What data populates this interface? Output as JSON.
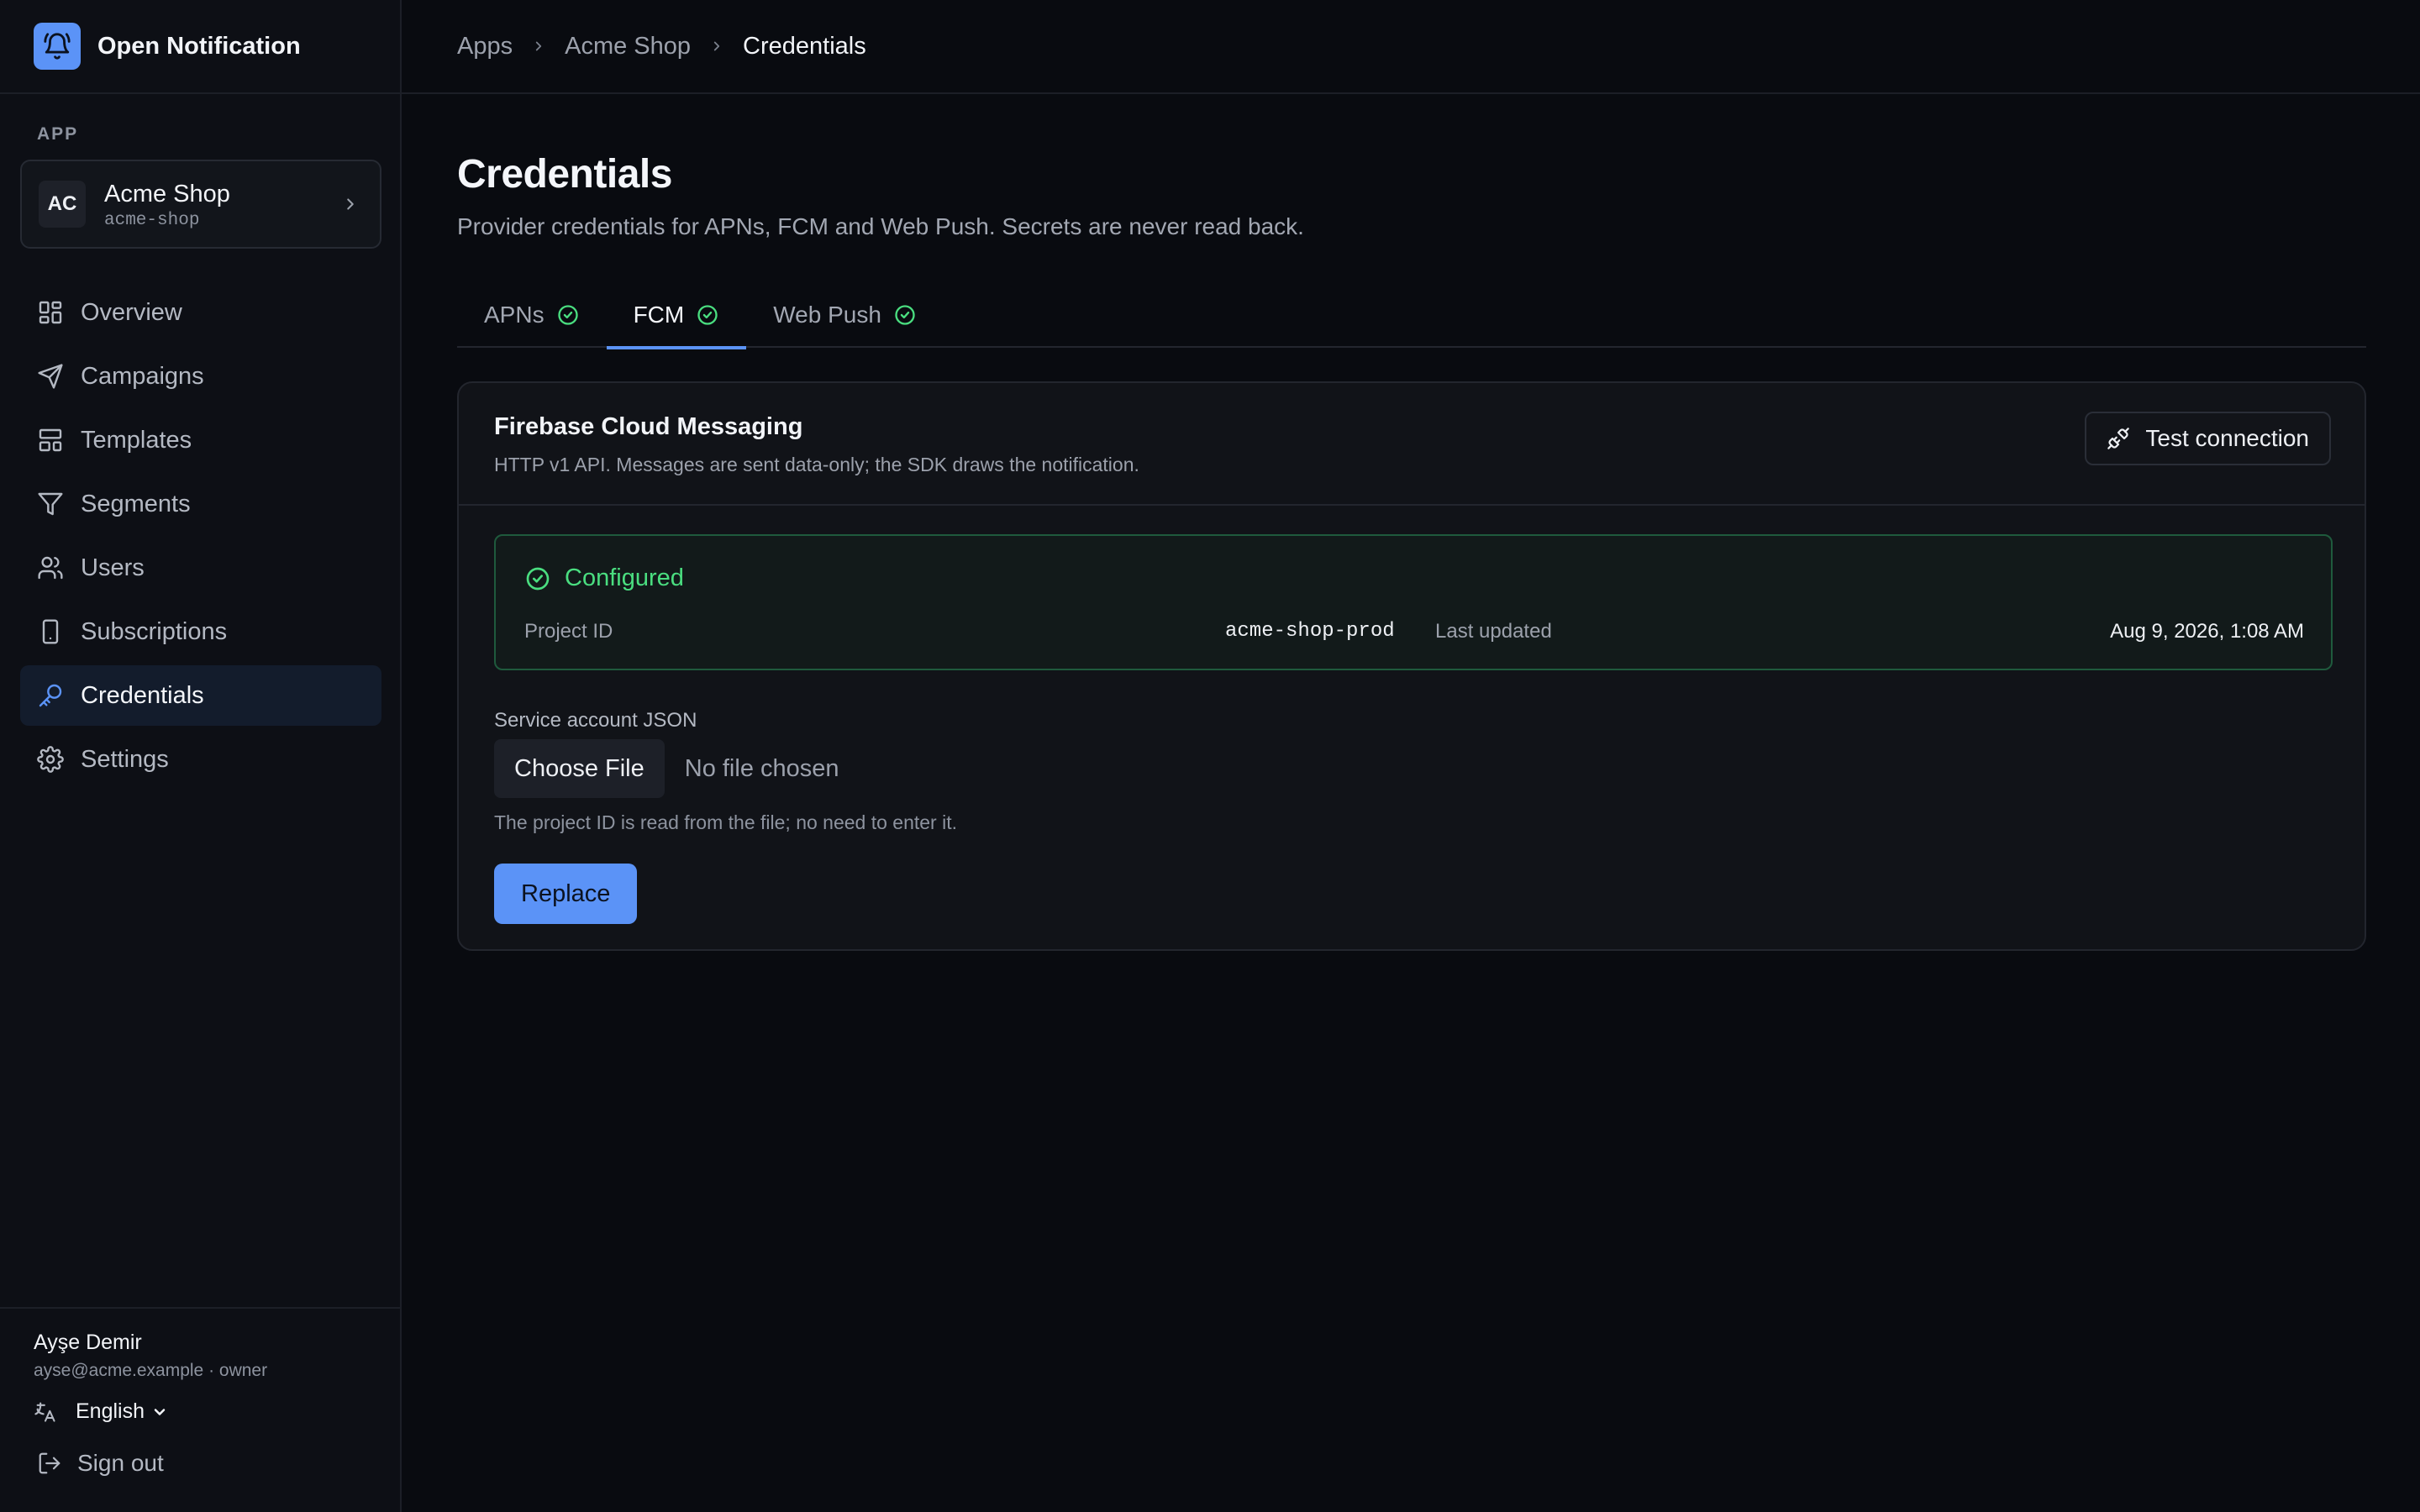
{
  "brand": {
    "name": "Open Notification"
  },
  "sidebar": {
    "section_label": "APP",
    "app": {
      "avatar": "AC",
      "name": "Acme Shop",
      "slug": "acme-shop"
    },
    "items": [
      {
        "label": "Overview",
        "icon": "grid-icon"
      },
      {
        "label": "Campaigns",
        "icon": "send-icon"
      },
      {
        "label": "Templates",
        "icon": "layout-icon"
      },
      {
        "label": "Segments",
        "icon": "filter-icon"
      },
      {
        "label": "Users",
        "icon": "users-icon"
      },
      {
        "label": "Subscriptions",
        "icon": "smartphone-icon"
      },
      {
        "label": "Credentials",
        "icon": "key-icon",
        "active": true
      },
      {
        "label": "Settings",
        "icon": "gear-icon"
      }
    ],
    "user": {
      "name": "Ayşe Demir",
      "meta": "ayse@acme.example · owner"
    },
    "language": "English",
    "signout": "Sign out"
  },
  "breadcrumb": [
    "Apps",
    "Acme Shop",
    "Credentials"
  ],
  "page": {
    "title": "Credentials",
    "subtitle": "Provider credentials for APNs, FCM and Web Push. Secrets are never read back."
  },
  "tabs": [
    {
      "label": "APNs",
      "configured": true
    },
    {
      "label": "FCM",
      "configured": true,
      "active": true
    },
    {
      "label": "Web Push",
      "configured": true
    }
  ],
  "card": {
    "title": "Firebase Cloud Messaging",
    "description": "HTTP v1 API. Messages are sent data-only; the SDK draws the notification.",
    "test_button": "Test connection",
    "status": {
      "label": "Configured",
      "project_id_label": "Project ID",
      "project_id": "acme-shop-prod",
      "updated_label": "Last updated",
      "updated": "Aug 9, 2026, 1:08 AM"
    },
    "field_label": "Service account JSON",
    "file_button": "Choose File",
    "file_status": "No file chosen",
    "hint": "The project ID is read from the file; no need to enter it.",
    "replace_button": "Replace"
  },
  "colors": {
    "accent": "#5b93f7",
    "success": "#4ade80",
    "background": "#090b10",
    "sidebar": "#0d0f15"
  }
}
